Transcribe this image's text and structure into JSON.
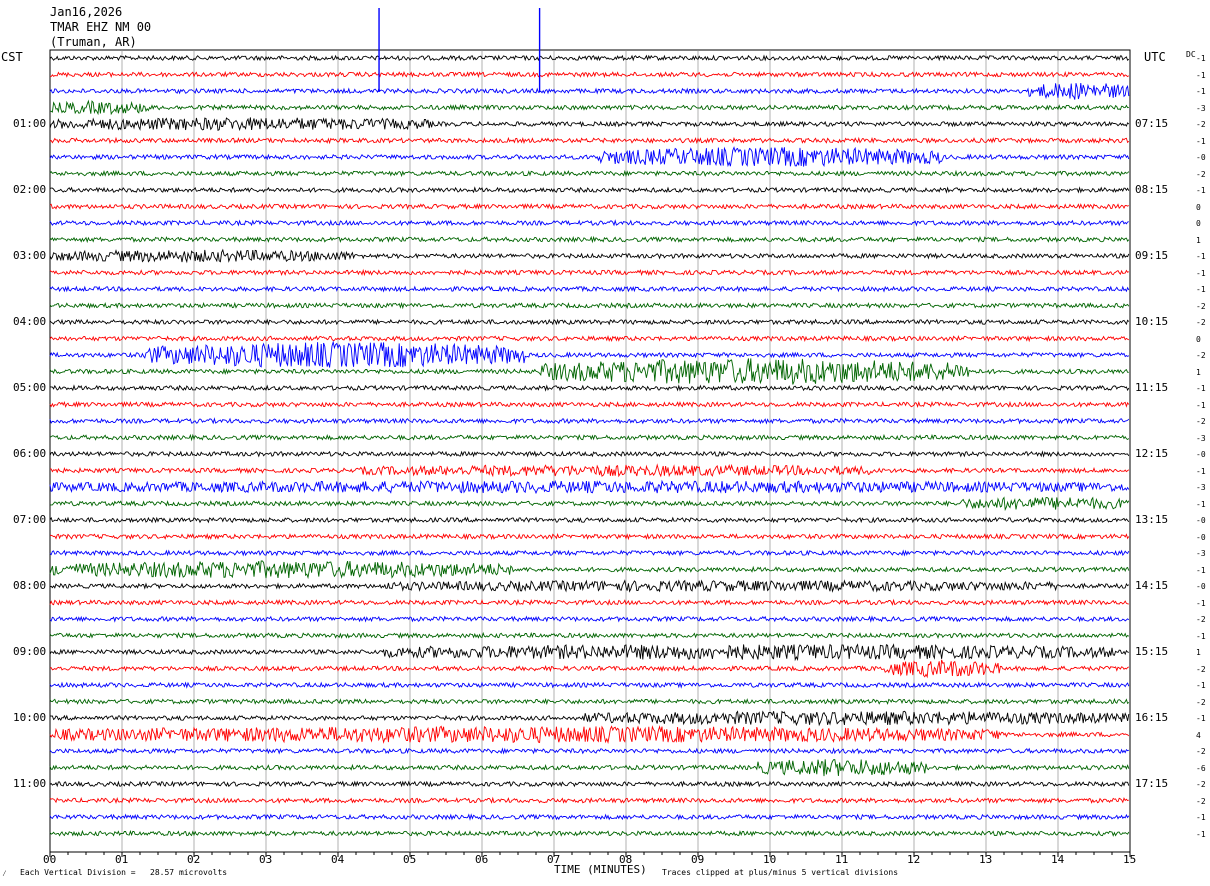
{
  "header": {
    "date": "Jan16,2026",
    "station": "TMAR EHZ NM 00",
    "location": "(Truman, AR)",
    "left_zone": "CST",
    "right_zone": "UTC",
    "dc_label": "DC"
  },
  "footer": {
    "scale_note": "Each Vertical Division =   28.57 microvolts",
    "x_axis_title": "TIME (MINUTES)",
    "clip_note": "Traces clipped at plus/minus 5 vertical divisions"
  },
  "chart_data": {
    "type": "line",
    "title": "",
    "xlabel": "TIME (MINUTES)",
    "ylabel": "",
    "xlim": [
      0,
      15
    ],
    "x_ticks": [
      "00",
      "01",
      "02",
      "03",
      "04",
      "05",
      "06",
      "07",
      "08",
      "09",
      "10",
      "11",
      "12",
      "13",
      "14",
      "15"
    ],
    "rows_per_hour": 4,
    "row_count": 48,
    "row_colors": [
      "#000000",
      "#ff0000",
      "#0000ff",
      "#006400"
    ],
    "left_hour_labels": [
      "01:00",
      "02:00",
      "03:00",
      "04:00",
      "05:00",
      "06:00",
      "07:00",
      "08:00",
      "09:00",
      "10:00",
      "11:00"
    ],
    "right_hour_labels": [
      "07:15",
      "08:15",
      "09:15",
      "10:15",
      "11:15",
      "12:15",
      "13:15",
      "14:15",
      "15:15",
      "16:15",
      "17:15"
    ],
    "dc_offsets": [
      "-1",
      "-1",
      "-1",
      "-3",
      "-2",
      "-1",
      "-0",
      "-2",
      "-1",
      "0",
      "0",
      "1",
      "-1",
      "-1",
      "-1",
      "-2",
      "-2",
      "0",
      "-2",
      "1",
      "-1",
      "-1",
      "-2",
      "-3",
      "-0",
      "-1",
      "-3",
      "-1",
      "-0",
      "-0",
      "-3",
      "-1",
      "-0",
      "-1",
      "-2",
      "-1",
      "1",
      "-2",
      "-1",
      "-2",
      "-1",
      "4",
      "-2",
      "-6",
      "-2",
      "-2",
      "-1",
      "-1"
    ],
    "events": [
      {
        "row": 2,
        "start": 13.6,
        "end": 15.0,
        "amp": 3.0
      },
      {
        "row": 3,
        "start": 0.0,
        "end": 1.4,
        "amp": 2.0
      },
      {
        "row": 4,
        "start": 0.0,
        "end": 5.3,
        "amp": 2.0
      },
      {
        "row": 6,
        "start": 7.6,
        "end": 12.4,
        "amp": 3.5
      },
      {
        "row": 12,
        "start": 0.0,
        "end": 4.2,
        "amp": 1.8
      },
      {
        "row": 18,
        "start": 1.3,
        "end": 6.6,
        "amp": 5.0
      },
      {
        "row": 19,
        "start": 6.8,
        "end": 12.8,
        "amp": 5.0
      },
      {
        "row": 25,
        "start": 4.3,
        "end": 11.5,
        "amp": 1.6
      },
      {
        "row": 26,
        "start": 0.0,
        "end": 15.0,
        "amp": 1.8
      },
      {
        "row": 27,
        "start": 12.6,
        "end": 15.0,
        "amp": 2.0
      },
      {
        "row": 31,
        "start": 0.0,
        "end": 6.4,
        "amp": 3.0
      },
      {
        "row": 32,
        "start": 4.6,
        "end": 14.0,
        "amp": 1.5
      },
      {
        "row": 36,
        "start": 4.6,
        "end": 14.8,
        "amp": 2.5
      },
      {
        "row": 37,
        "start": 11.6,
        "end": 13.2,
        "amp": 3.0
      },
      {
        "row": 40,
        "start": 7.4,
        "end": 15.0,
        "amp": 2.2
      },
      {
        "row": 41,
        "start": 0.0,
        "end": 13.2,
        "amp": 2.8
      },
      {
        "row": 43,
        "start": 9.8,
        "end": 12.2,
        "amp": 3.0
      }
    ]
  }
}
